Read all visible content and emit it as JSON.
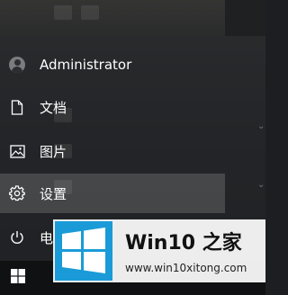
{
  "start_menu": {
    "items": [
      {
        "id": "user",
        "label": "Administrator",
        "icon": "user-avatar-icon"
      },
      {
        "id": "documents",
        "label": "文档",
        "icon": "document-icon"
      },
      {
        "id": "pictures",
        "label": "图片",
        "icon": "picture-icon"
      },
      {
        "id": "settings",
        "label": "设置",
        "icon": "gear-icon",
        "highlighted": true
      },
      {
        "id": "power",
        "label": "电",
        "icon": "power-icon"
      }
    ]
  },
  "taskbar": {
    "start_icon": "windows-logo-icon"
  },
  "watermark": {
    "title": "Win10 之家",
    "url": "www.win10xitong.com",
    "logo_color": "#1a9bd7"
  },
  "colors": {
    "background": "#232528",
    "highlight": "#4a4c4f",
    "taskbar": "#101113",
    "text": "#ffffff"
  }
}
